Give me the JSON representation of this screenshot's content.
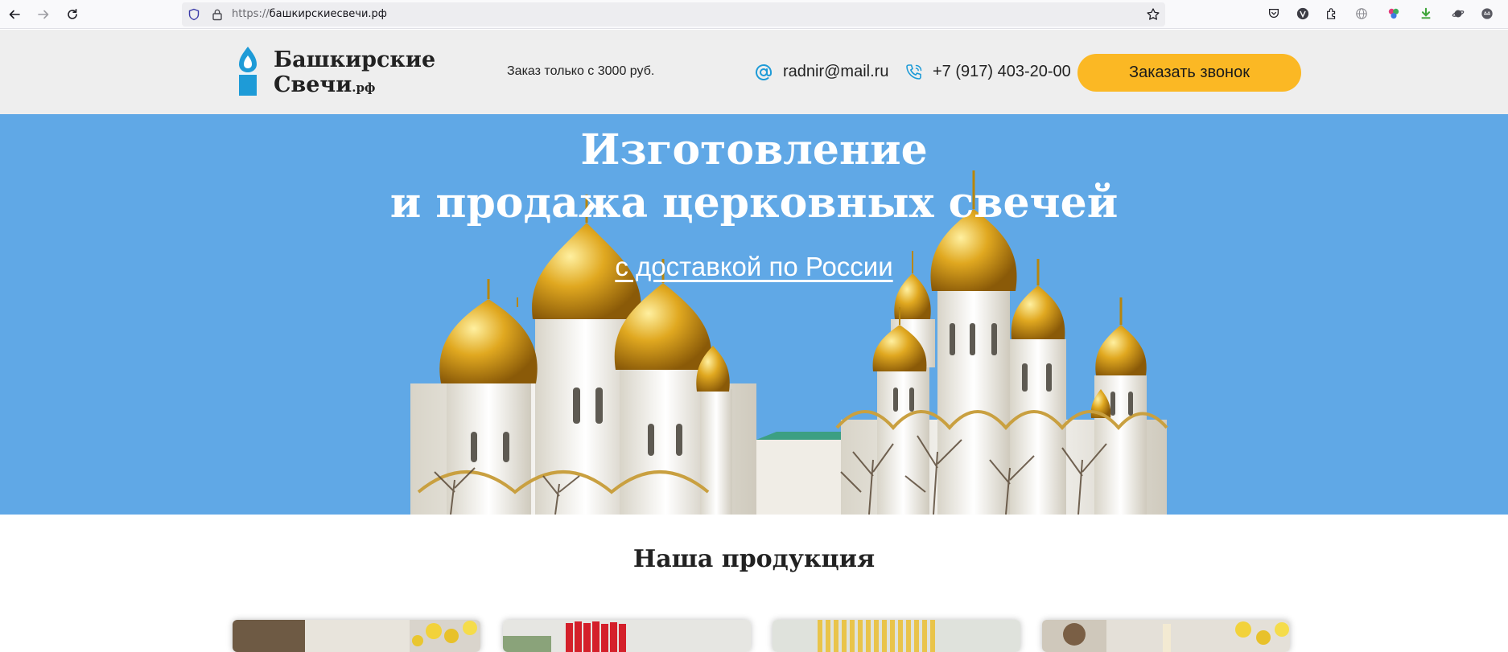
{
  "browser": {
    "url_protocol": "https://",
    "url_host": "башкирскиесвечи.рф"
  },
  "header": {
    "logo_line1": "Башкирские",
    "logo_line2": "Свечи",
    "logo_suffix": ".рф",
    "order_note": "Заказ только с 3000 руб.",
    "email": "radnir@mail.ru",
    "phone": "+7 (917) 403-20-00",
    "call_button": "Заказать звонок"
  },
  "hero": {
    "title_line1": "Изготовление",
    "title_line2": "и продажа церковных свечей",
    "subtitle": "с доставкой по России"
  },
  "products": {
    "title": "Наша продукция",
    "cards": [
      "candles-in-basket",
      "red-candles",
      "yellow-candles",
      "candles-with-flowers"
    ]
  },
  "colors": {
    "accent": "#fbb824",
    "hero_blue": "#60a8e6",
    "logo_blue": "#1e9bd7",
    "header_bg": "#eeeeee"
  },
  "icons": {
    "back": "arrow-left",
    "forward": "arrow-right",
    "reload": "reload",
    "shield": "shield",
    "lock": "lock",
    "bookmark": "star",
    "email": "at-sign",
    "phone": "phone"
  }
}
